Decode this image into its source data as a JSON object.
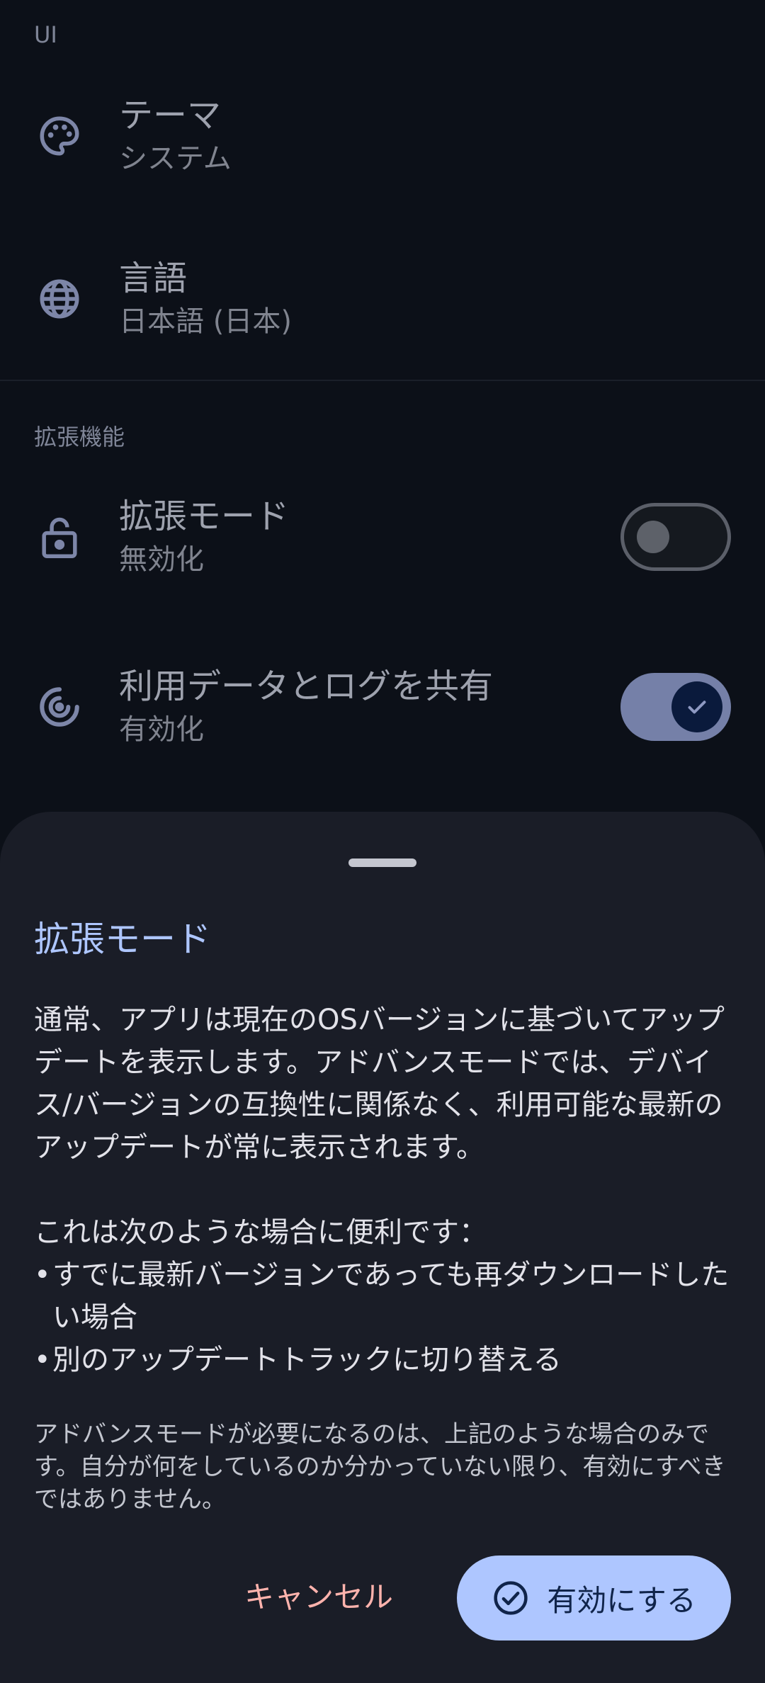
{
  "settings": {
    "section_ui": "UI",
    "theme": {
      "title": "テーマ",
      "value": "システム",
      "icon": "palette-icon"
    },
    "language": {
      "title": "言語",
      "value": "日本語 (日本)",
      "icon": "globe-icon"
    },
    "section_ext": "拡張機能",
    "advanced_mode": {
      "title": "拡張モード",
      "value": "無効化",
      "icon": "lock-icon",
      "enabled": false
    },
    "share_data": {
      "title": "利用データとログを共有",
      "value": "有効化",
      "icon": "fingerprint-icon",
      "enabled": true
    }
  },
  "sheet": {
    "title": "拡張モード",
    "paragraph1": "通常、アプリは現在のOSバージョンに基づいてアップデートを表示します。アドバンスモードでは、デバイス/バージョンの互換性に関係なく、利用可能な最新のアップデートが常に表示されます。",
    "useful_intro": "これは次のような場合に便利です：",
    "bullets": [
      "すでに最新バージョンであっても再ダウンロードしたい場合",
      "別のアップデートトラックに切り替える"
    ],
    "bullet_marker": "•",
    "note": "アドバンスモードが必要になるのは、上記のような場合のみです。自分が何をしているのか分かっていない限り、有効にすべきではありません。",
    "cancel_label": "キャンセル",
    "enable_label": "有効にする"
  },
  "colors": {
    "background": "#0c1018",
    "sheet": "#1a1d27",
    "accent": "#aec6ff",
    "cancel": "#ffb3ad"
  }
}
